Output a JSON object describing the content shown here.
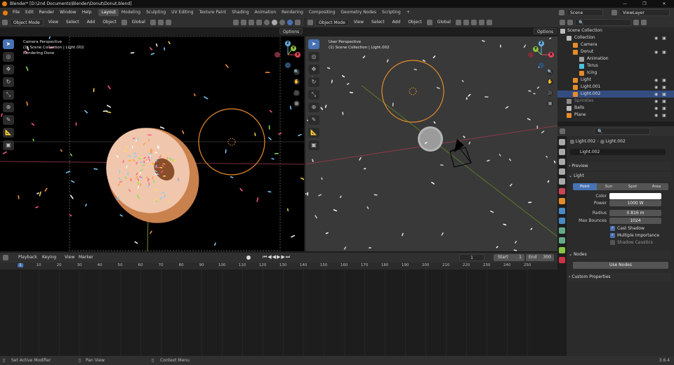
{
  "title_bar": {
    "title": "Blender* [D:\\2nd Documents\\Blender\\Donut\\Donut.blend]",
    "controls": [
      "—",
      "❐",
      "✕"
    ]
  },
  "menu": {
    "items": [
      "File",
      "Edit",
      "Render",
      "Window",
      "Help"
    ],
    "workspaces": [
      "Layout",
      "Modeling",
      "Sculpting",
      "UV Editing",
      "Texture Paint",
      "Shading",
      "Animation",
      "Rendering",
      "Compositing",
      "Geometry Nodes",
      "Scripting"
    ],
    "active_workspace": "Layout",
    "add_tab": "+",
    "scene_label": "Scene",
    "view_layer_label": "ViewLayer"
  },
  "viewport_left": {
    "mode": "Object Mode",
    "menus": [
      "View",
      "Select",
      "Add",
      "Object"
    ],
    "orientation": "Global",
    "options": "Options",
    "overlay": {
      "line1": "Camera Perspective",
      "line2": "(1) Scene Collection | Light.002",
      "line3": "Rendering Done"
    }
  },
  "viewport_right": {
    "mode": "Object Mode",
    "menus": [
      "View",
      "Select",
      "Add",
      "Object"
    ],
    "orientation": "Global",
    "options": "Options",
    "overlay": {
      "line1": "User Perspective",
      "line2": "(1) Scene Collection | Light.002"
    }
  },
  "gizmo_labels": {
    "x": "X",
    "y": "Y",
    "z": "Z"
  },
  "outliner": {
    "search_placeholder": "",
    "root": "Scene Collection",
    "rows": [
      {
        "label": "Collection",
        "color": "#bbbbbb"
      },
      {
        "label": "Camera",
        "color": "#e58c2a"
      },
      {
        "label": "Donut",
        "color": "#e58c2a"
      },
      {
        "label": "Animation",
        "color": "#a0a0a0"
      },
      {
        "label": "Torus",
        "color": "#4ec0e0"
      },
      {
        "label": "Icing",
        "color": "#e58c2a"
      },
      {
        "label": "Light",
        "color": "#e58c2a"
      },
      {
        "label": "Light.001",
        "color": "#e58c2a"
      },
      {
        "label": "Light.002",
        "color": "#e58c2a"
      },
      {
        "label": "Sprinkles",
        "color": "#888888"
      },
      {
        "label": "Balls",
        "color": "#bbbbbb"
      },
      {
        "label": "Plane",
        "color": "#e58c2a"
      }
    ]
  },
  "properties": {
    "breadcrumb_object": "Light.002",
    "breadcrumb_data": "Light.002",
    "datablock_name": "Light.002",
    "preview_label": "Preview",
    "light_label": "Light",
    "types": [
      "Point",
      "Sun",
      "Spot",
      "Area"
    ],
    "active_type": "Point",
    "color_label": "Color",
    "color_value": "#ffffff",
    "power_label": "Power",
    "power_value": "1000 W",
    "radius_label": "Radius",
    "radius_value": "0.816 m",
    "bounces_label": "Max Bounces",
    "bounces_value": "1024",
    "cast_shadow": "Cast Shadow",
    "multiple_importance": "Multiple Importance",
    "shadow_caustics": "Shadow Caustics",
    "nodes_label": "Nodes",
    "use_nodes": "Use Nodes",
    "custom_props": "Custom Properties"
  },
  "timeline": {
    "menus": [
      "Playback",
      "Keying",
      "View",
      "Marker"
    ],
    "current_frame": "1",
    "start_label": "Start",
    "start": "1",
    "end_label": "End",
    "end": "300",
    "ticks": [
      "1",
      "10",
      "20",
      "30",
      "40",
      "50",
      "60",
      "70",
      "80",
      "90",
      "100",
      "110",
      "120",
      "130",
      "140",
      "150",
      "160",
      "170",
      "180",
      "190",
      "200",
      "210",
      "220",
      "230",
      "240",
      "250"
    ]
  },
  "status": {
    "left": "Set Active Modifier",
    "middle": "Pan View",
    "right": "Context Menu",
    "version": "3.6.4"
  }
}
